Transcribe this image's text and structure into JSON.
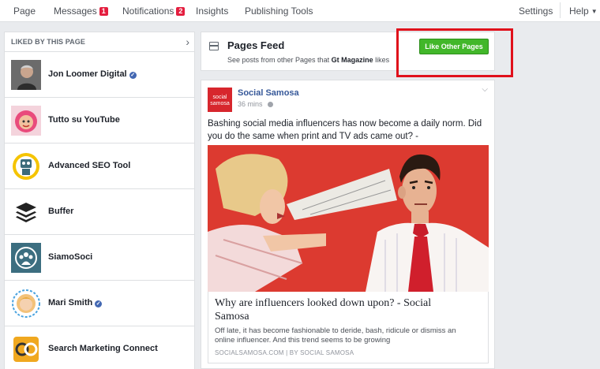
{
  "topnav": {
    "items": [
      {
        "label": "Page"
      },
      {
        "label": "Messages",
        "badge": "1"
      },
      {
        "label": "Notifications",
        "badge": "2"
      },
      {
        "label": "Insights"
      },
      {
        "label": "Publishing Tools"
      }
    ],
    "settings": "Settings",
    "help": "Help"
  },
  "liked_panel": {
    "title": "LIKED BY THIS PAGE",
    "pages": [
      {
        "name": "Jon Loomer Digital",
        "verified": true
      },
      {
        "name": "Tutto su YouTube",
        "verified": false
      },
      {
        "name": "Advanced SEO Tool",
        "verified": false
      },
      {
        "name": "Buffer",
        "verified": false
      },
      {
        "name": "SiamoSoci",
        "verified": false
      },
      {
        "name": "Mari Smith",
        "verified": true
      },
      {
        "name": "Search Marketing Connect",
        "verified": false
      }
    ]
  },
  "pages_feed": {
    "title": "Pages Feed",
    "subtitle_prefix": "See posts from other Pages that",
    "subtitle_page": "Gt Magazine",
    "subtitle_suffix": "likes",
    "button": "Like Other Pages"
  },
  "post": {
    "logo_text_line1": "social",
    "logo_text_line2": "samosa",
    "author": "Social Samosa",
    "time": "36 mins",
    "text": "Bashing social media influencers has now become a daily norm. Did you do the same when print and TV ads came out? -",
    "link": {
      "title": "Why are influencers looked down upon? - Social Samosa",
      "description": "Off late, it has become fashionable to deride, bash, ridicule or dismiss an online influencer. And this trend seems to be growing",
      "source": "SOCIALSAMOSA.COM | BY SOCIAL SAMOSA"
    }
  },
  "colors": {
    "accent_link": "#365899",
    "button_green": "#42b72a",
    "badge_red": "#e41e3f",
    "highlight_red": "#e0101b",
    "image_bg_red": "#d9322a"
  }
}
